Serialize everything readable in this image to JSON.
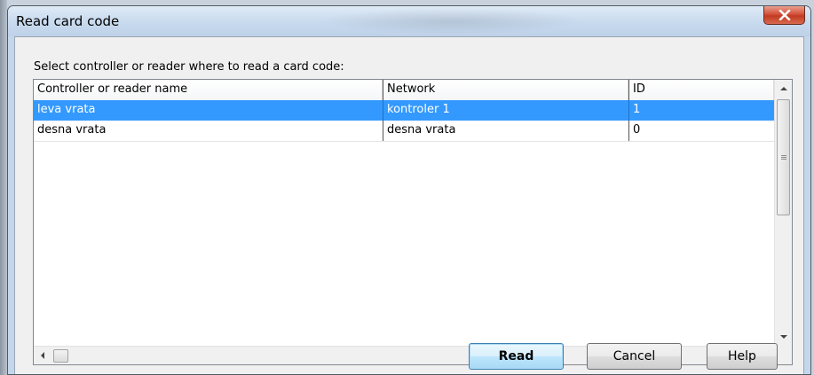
{
  "window": {
    "title": "Read card code",
    "close_icon": "close-x-icon"
  },
  "prompt_text": "Select controller or reader where to read a card code:",
  "columns": {
    "name": "Controller or reader name",
    "network": "Network",
    "id": "ID"
  },
  "rows": [
    {
      "name": "leva vrata",
      "network": "kontroler 1",
      "id": "1",
      "selected": true
    },
    {
      "name": "desna vrata",
      "network": "desna vrata",
      "id": "0",
      "selected": false
    }
  ],
  "buttons": {
    "read": "Read",
    "cancel": "Cancel",
    "help": "Help"
  },
  "colors": {
    "selection": "#3399ff",
    "close_button": "#c23a22",
    "default_button_border": "#3c7fb1"
  }
}
